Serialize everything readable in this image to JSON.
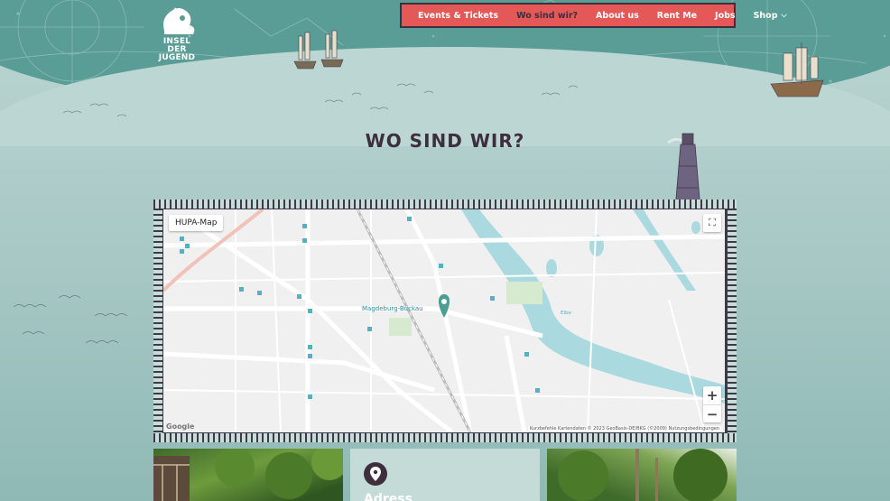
{
  "brand": {
    "logo_text": "INSEL DER JUGEND"
  },
  "nav": {
    "items": [
      {
        "label": "Events & Tickets",
        "active": false
      },
      {
        "label": "Wo sind wir?",
        "active": true
      },
      {
        "label": "About us",
        "active": false
      },
      {
        "label": "Rent Me",
        "active": false
      },
      {
        "label": "Jobs",
        "active": false
      },
      {
        "label": "Shop",
        "active": false,
        "has_dropdown": true
      }
    ]
  },
  "page_title": "WO SIND WIR?",
  "map": {
    "map_type_label": "HUPA-Map",
    "station_label": "Magdeburg-Buckau",
    "river_label": "Elbe",
    "google_logo": "Google",
    "attribution": "Kurzbefehle   Kartendaten © 2023 GeoBasis-DE/BKG (©2009)   Nutzungsbedingungen",
    "zoom_in": "+",
    "zoom_out": "−",
    "fullscreen_icon": "fullscreen-icon"
  },
  "info_card": {
    "heading": "Adress"
  },
  "colors": {
    "nav_bg": "#e45858",
    "nav_active": "#3d2f3e",
    "title": "#3d2f3e",
    "sky": "#5a9d97",
    "frame": "#3e3a48"
  }
}
